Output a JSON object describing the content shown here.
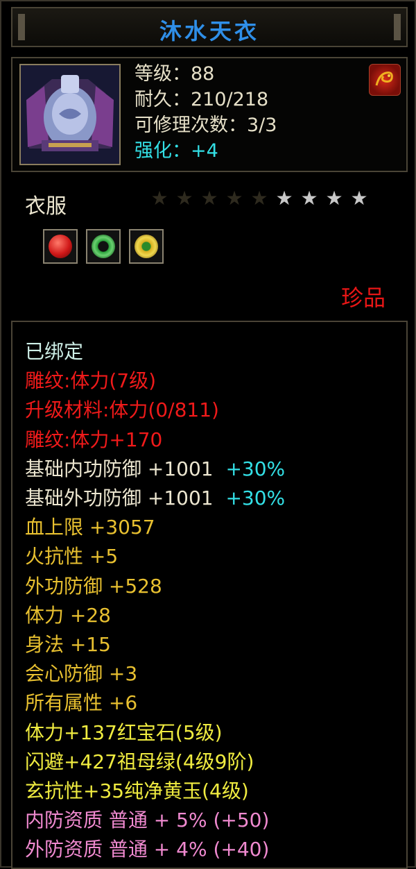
{
  "title": "沐水天衣",
  "header": {
    "level": "等级：88",
    "durability": "耐久：210/218",
    "repair": "可修理次数：3/3",
    "enhance": "强化：+4"
  },
  "category": "衣服",
  "stars": {
    "total": 9,
    "lit": 4
  },
  "gems": [
    {
      "icon": "ruby-gem-icon",
      "color": "#d01818"
    },
    {
      "icon": "emerald-ring-icon",
      "color": "#2aa03a"
    },
    {
      "icon": "topaz-gem-icon",
      "color": "#d8b020"
    }
  ],
  "quality": "珍品",
  "attributes": {
    "bound": "已绑定",
    "carve1": "雕纹:体力(7级)",
    "upgrade": "升级材料:体力(0/811)",
    "carve2": "雕纹:体力+170",
    "inner_def": "基础内功防御  +1001",
    "inner_def_pct": "+30%",
    "outer_def": "基础外功防御  +1001",
    "outer_def_pct": "+30%",
    "hp": "血上限  +3057",
    "fire_res": "火抗性  +5",
    "ext_def": "外功防御  +528",
    "stamina": "体力  +28",
    "agility": "身法  +15",
    "crit_def": "会心防御  +3",
    "all_attr": "所有属性  +6",
    "gem1": "体力+137红宝石(5级)",
    "gem2": "闪避+427祖母绿(4级9阶)",
    "gem3": "玄抗性+35纯净黄玉(4级)",
    "quality_inner": "内防资质  普通  +  5%  (+50)",
    "quality_outer": "外防资质  普通  +  4%  (+40)"
  }
}
